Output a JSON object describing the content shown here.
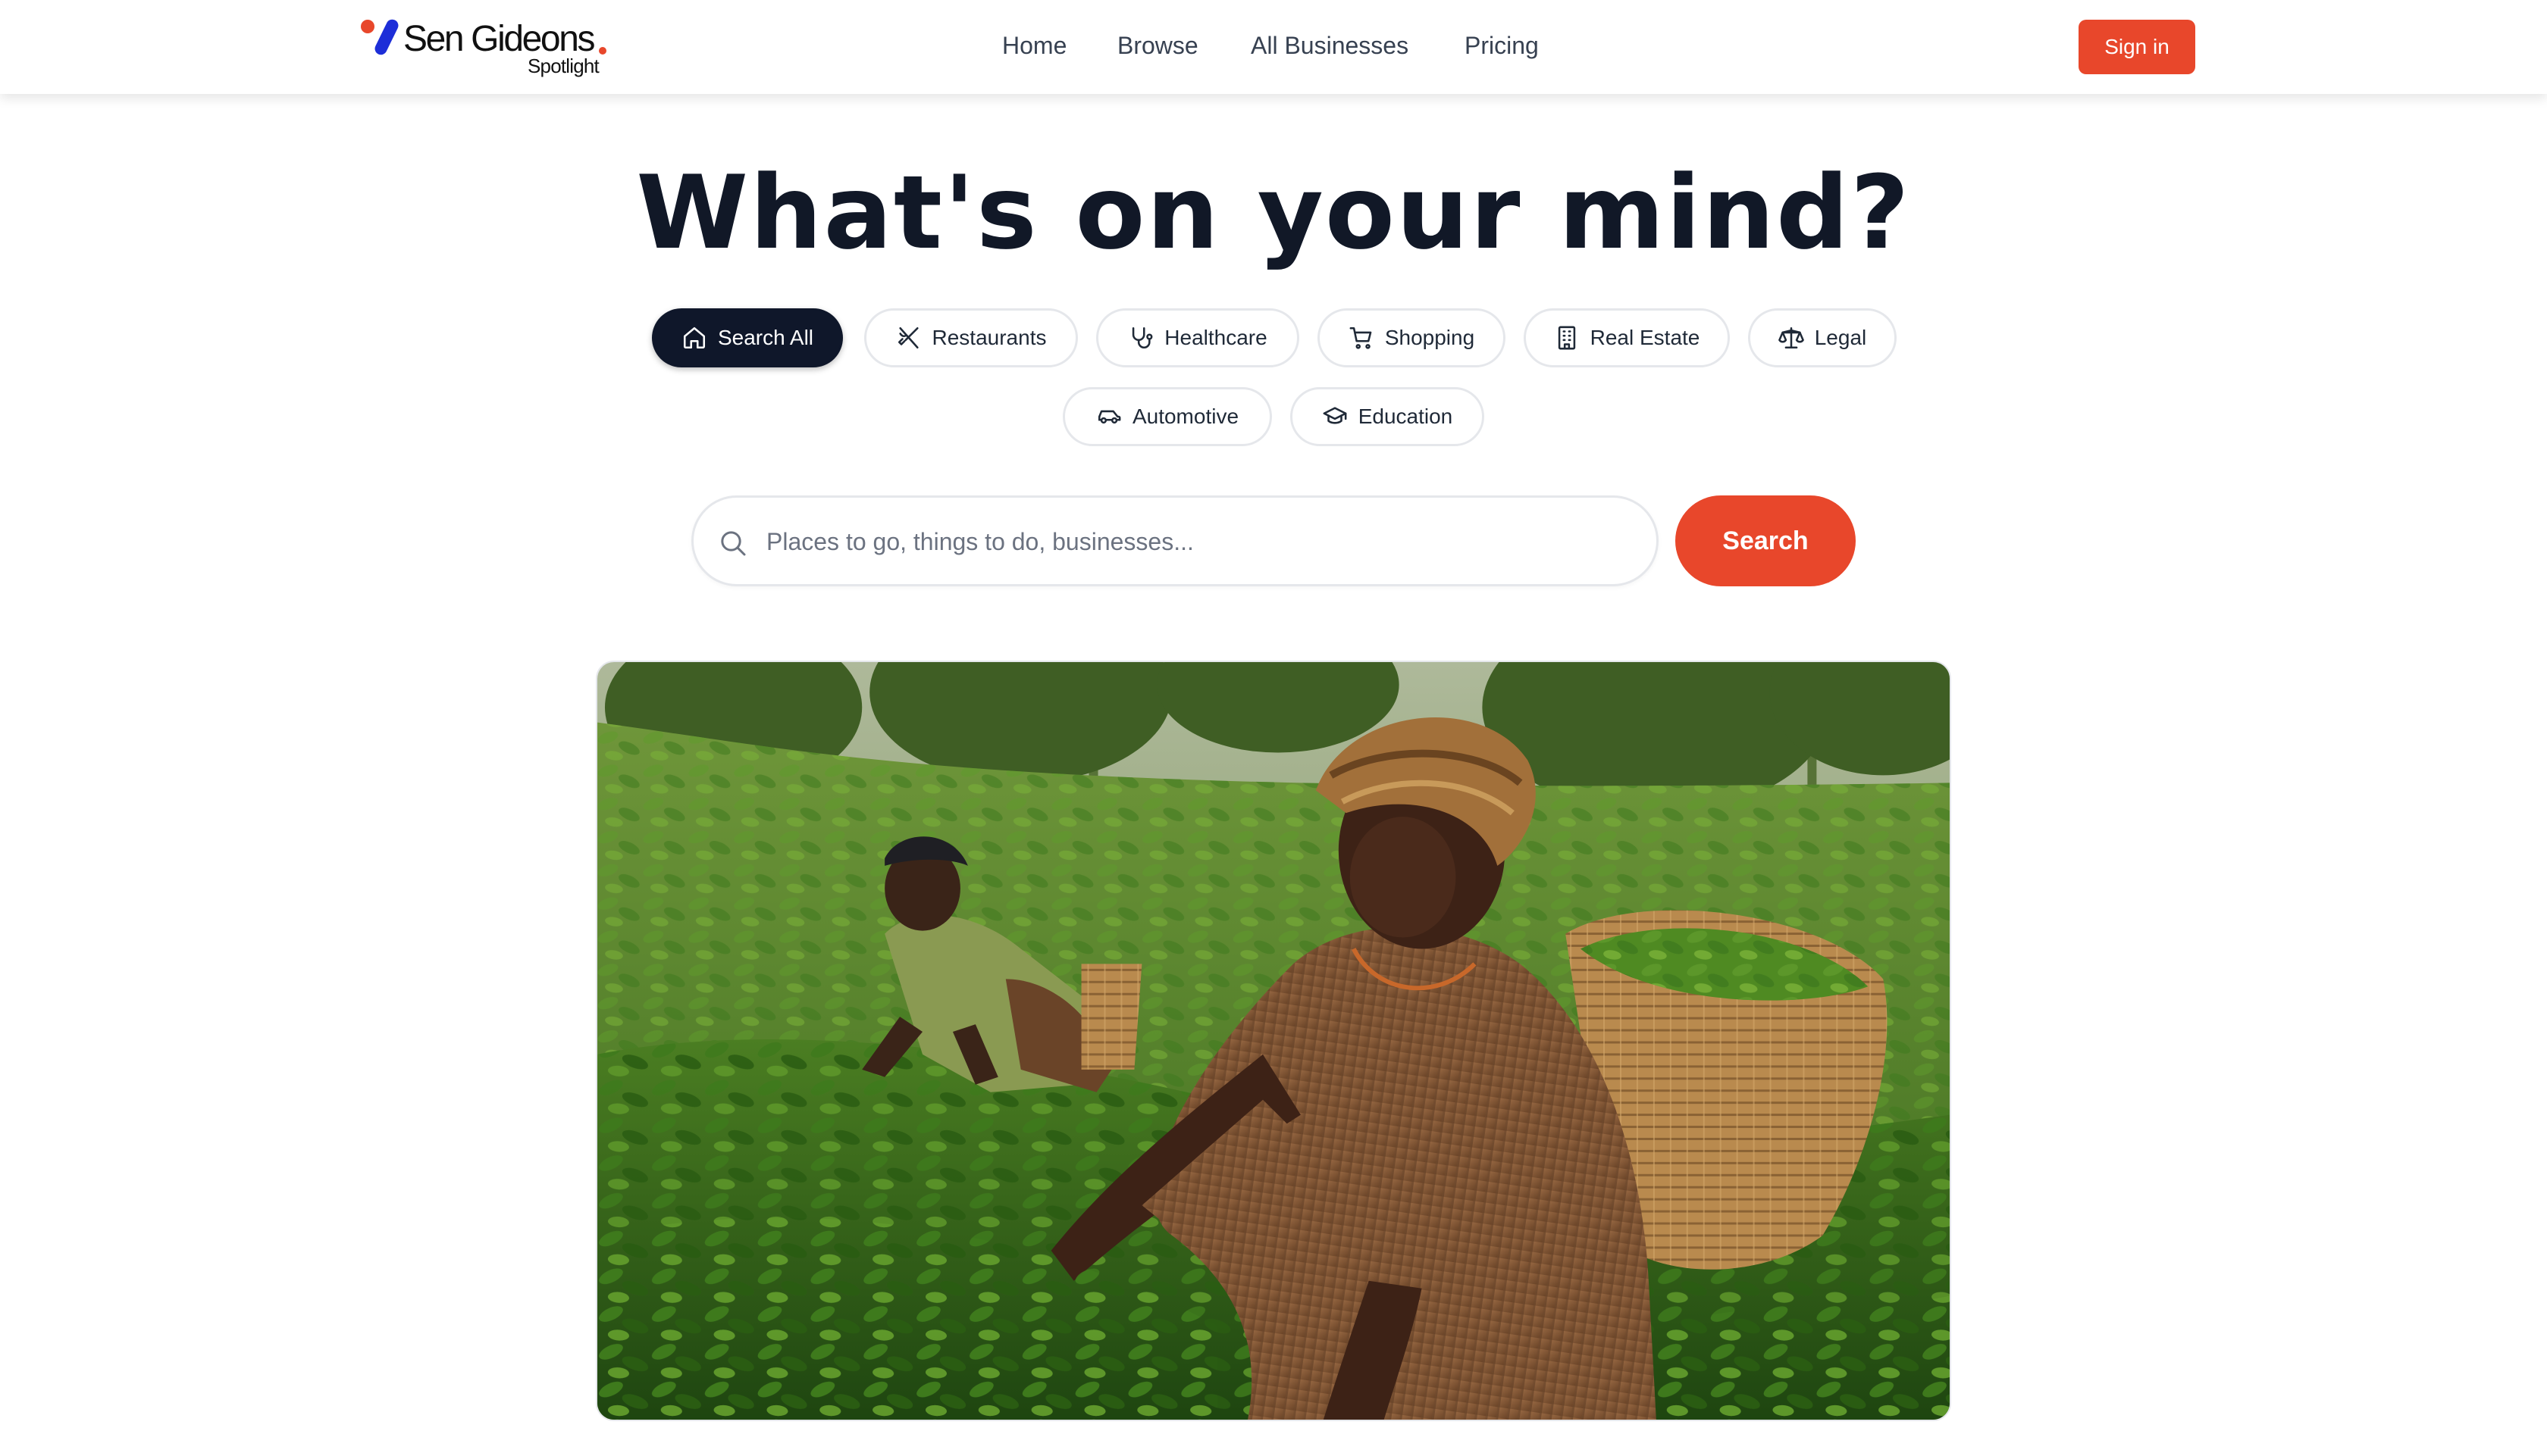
{
  "brand": {
    "name": "Sen Gideons",
    "sub": "Spotlight",
    "dot_color": "#e8472b",
    "slash_color": "#1d2ed8"
  },
  "nav": {
    "items": [
      {
        "label": "Home"
      },
      {
        "label": "Browse"
      },
      {
        "label": "All Businesses"
      },
      {
        "label": "Pricing"
      }
    ],
    "signin_label": "Sign in"
  },
  "hero": {
    "title": "What's on your mind?"
  },
  "categories": [
    {
      "label": "Search All",
      "icon": "home-icon",
      "active": true
    },
    {
      "label": "Restaurants",
      "icon": "utensils-icon",
      "active": false
    },
    {
      "label": "Healthcare",
      "icon": "stethoscope-icon",
      "active": false
    },
    {
      "label": "Shopping",
      "icon": "cart-icon",
      "active": false
    },
    {
      "label": "Real Estate",
      "icon": "building-icon",
      "active": false
    },
    {
      "label": "Legal",
      "icon": "scale-icon",
      "active": false
    },
    {
      "label": "Automotive",
      "icon": "car-icon",
      "active": false
    },
    {
      "label": "Education",
      "icon": "graduation-cap-icon",
      "active": false
    }
  ],
  "search": {
    "placeholder": "Places to go, things to do, businesses...",
    "value": "",
    "button_label": "Search",
    "icon": "search-icon"
  },
  "colors": {
    "accent": "#e8472b",
    "dark": "#0f172a",
    "text": "#111827"
  },
  "hero_image": {
    "alt": "Two women picking tea leaves on a green tea plantation"
  }
}
